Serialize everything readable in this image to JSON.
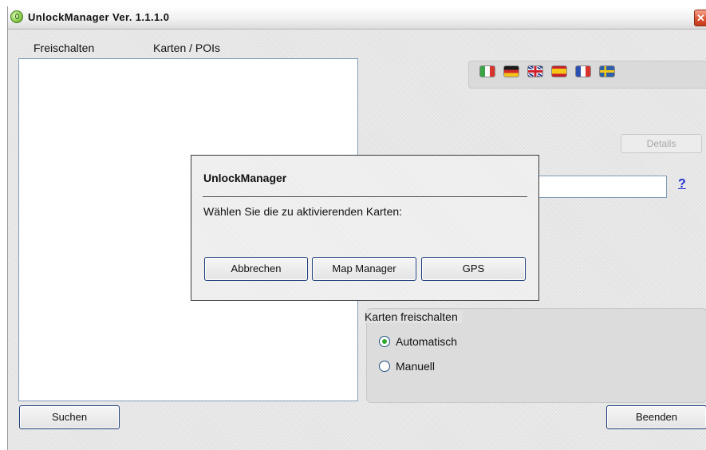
{
  "window": {
    "title": "UnlockManager Ver. 1.1.1.0",
    "close_glyph": "✕"
  },
  "list": {
    "columns": [
      "Freischalten",
      "Karten / POIs"
    ]
  },
  "languages": {
    "flags": [
      "italian",
      "german",
      "english",
      "spanish",
      "french",
      "swedish"
    ]
  },
  "details_label": "Details",
  "help_label": "?",
  "unlock_group": {
    "title": "Karten freischalten",
    "options": [
      {
        "label": "Automatisch",
        "selected": true
      },
      {
        "label": "Manuell",
        "selected": false
      }
    ]
  },
  "footer": {
    "search_label": "Suchen",
    "exit_label": "Beenden"
  },
  "dialog": {
    "title": "UnlockManager",
    "message": "Wählen Sie die zu aktivierenden Karten:",
    "buttons": [
      "Abbrechen",
      "Map Manager",
      "GPS"
    ]
  },
  "colors": {
    "accent_blue": "#1c3c7a",
    "radio_selected": "#2fa82f",
    "help_link": "#1a2ecf"
  }
}
